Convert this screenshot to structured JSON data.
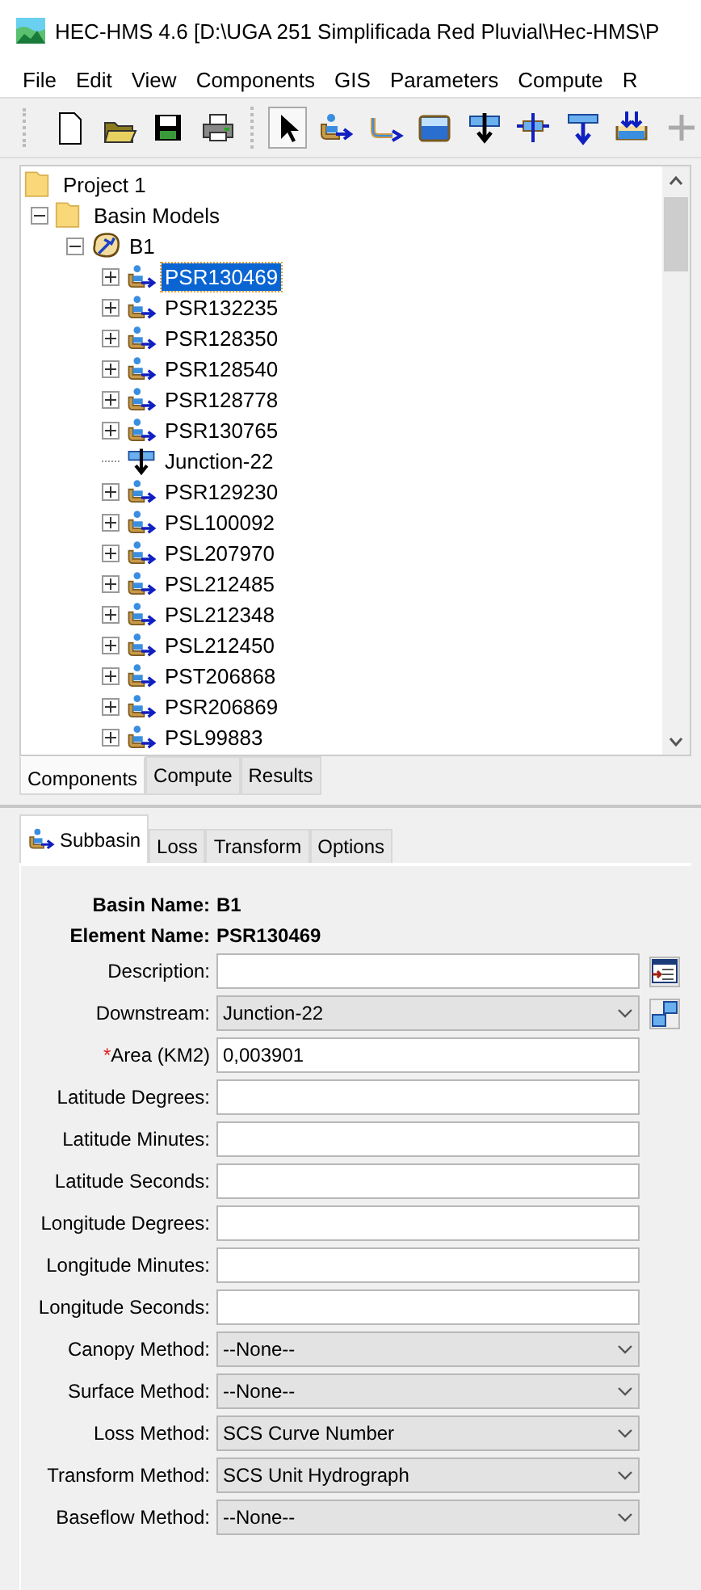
{
  "window": {
    "title": "HEC-HMS 4.6 [D:\\UGA 251 Simplificada Red Pluvial\\Hec-HMS\\P"
  },
  "menu": [
    "File",
    "Edit",
    "View",
    "Components",
    "GIS",
    "Parameters",
    "Compute",
    "R"
  ],
  "toolbar": [
    {
      "kind": "new",
      "selected": false
    },
    {
      "kind": "open",
      "selected": false
    },
    {
      "kind": "save",
      "selected": false
    },
    {
      "kind": "print",
      "selected": false
    },
    {
      "kind": "pointer",
      "selected": true
    },
    {
      "kind": "subbasin",
      "selected": false
    },
    {
      "kind": "reach",
      "selected": false
    },
    {
      "kind": "reservoir",
      "selected": false
    },
    {
      "kind": "junction",
      "selected": false
    },
    {
      "kind": "diversion",
      "selected": false
    },
    {
      "kind": "source",
      "selected": false
    },
    {
      "kind": "sink",
      "selected": false
    },
    {
      "kind": "add",
      "selected": false
    }
  ],
  "tree": [
    {
      "label": "Project 1",
      "kind": "folder",
      "selected": false,
      "children": [
        {
          "label": "Basin Models",
          "kind": "folder",
          "expanded": true,
          "selected": false,
          "children": [
            {
              "label": "B1",
              "kind": "basin",
              "expanded": true,
              "selected": false,
              "children": [
                {
                  "label": "PSR130469",
                  "kind": "subbasin",
                  "expanded": false,
                  "selected": true
                },
                {
                  "label": "PSR132235",
                  "kind": "subbasin",
                  "expanded": false,
                  "selected": false
                },
                {
                  "label": "PSR128350",
                  "kind": "subbasin",
                  "expanded": false,
                  "selected": false
                },
                {
                  "label": "PSR128540",
                  "kind": "subbasin",
                  "expanded": false,
                  "selected": false
                },
                {
                  "label": "PSR128778",
                  "kind": "subbasin",
                  "expanded": false,
                  "selected": false
                },
                {
                  "label": "PSR130765",
                  "kind": "subbasin",
                  "expanded": false,
                  "selected": false
                },
                {
                  "label": "Junction-22",
                  "kind": "junction",
                  "selected": false
                },
                {
                  "label": "PSR129230",
                  "kind": "subbasin",
                  "expanded": false,
                  "selected": false
                },
                {
                  "label": "PSL100092",
                  "kind": "subbasin",
                  "expanded": false,
                  "selected": false
                },
                {
                  "label": "PSL207970",
                  "kind": "subbasin",
                  "expanded": false,
                  "selected": false
                },
                {
                  "label": "PSL212485",
                  "kind": "subbasin",
                  "expanded": false,
                  "selected": false
                },
                {
                  "label": "PSL212348",
                  "kind": "subbasin",
                  "expanded": false,
                  "selected": false
                },
                {
                  "label": "PSL212450",
                  "kind": "subbasin",
                  "expanded": false,
                  "selected": false
                },
                {
                  "label": "PST206868",
                  "kind": "subbasin",
                  "expanded": false,
                  "selected": false
                },
                {
                  "label": "PSR206869",
                  "kind": "subbasin",
                  "expanded": false,
                  "selected": false
                },
                {
                  "label": "PSL99883",
                  "kind": "subbasin",
                  "expanded": false,
                  "selected": false
                }
              ]
            }
          ]
        }
      ]
    }
  ],
  "explorer_tabs": [
    {
      "label": "Components",
      "selected": true
    },
    {
      "label": "Compute",
      "selected": false
    },
    {
      "label": "Results",
      "selected": false
    }
  ],
  "editor_tabs": [
    {
      "label": "Subbasin",
      "selected": true
    },
    {
      "label": "Loss",
      "selected": false
    },
    {
      "label": "Transform",
      "selected": false
    },
    {
      "label": "Options",
      "selected": false
    }
  ],
  "header": [
    {
      "label": "Basin Name:",
      "value": "B1"
    },
    {
      "label": "Element Name:",
      "value": "PSR130469"
    }
  ],
  "fields": [
    {
      "label": "Description:",
      "kind": "text"
    },
    {
      "label": "Downstream:",
      "kind": "select",
      "value": "Junction-22"
    },
    {
      "label": "Area (KM2)",
      "required_mark": "*",
      "kind": "text",
      "value": "0,003901"
    },
    {
      "label": "Latitude Degrees:",
      "kind": "text"
    },
    {
      "label": "Latitude Minutes:",
      "kind": "text"
    },
    {
      "label": "Latitude Seconds:",
      "kind": "text"
    },
    {
      "label": "Longitude Degrees:",
      "kind": "text"
    },
    {
      "label": "Longitude Minutes:",
      "kind": "text"
    },
    {
      "label": "Longitude Seconds:",
      "kind": "text"
    },
    {
      "label": "Canopy Method:",
      "kind": "select",
      "value": "--None--"
    },
    {
      "label": "Surface Method:",
      "kind": "select",
      "value": "--None--"
    },
    {
      "label": "Loss Method:",
      "kind": "select",
      "value": "SCS Curve Number"
    },
    {
      "label": "Transform Method:",
      "kind": "select",
      "value": "SCS Unit Hydrograph"
    },
    {
      "label": "Baseflow Method:",
      "kind": "select",
      "value": "--None--"
    }
  ]
}
